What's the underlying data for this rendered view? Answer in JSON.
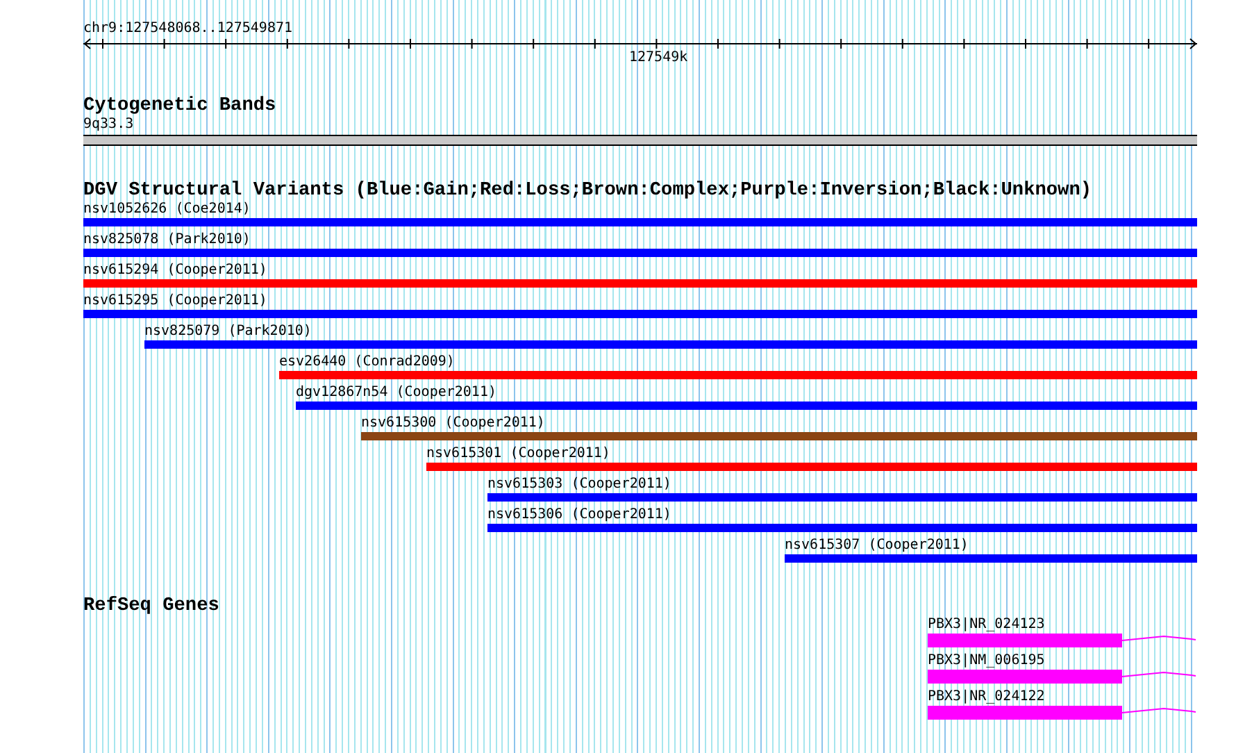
{
  "ruler": {
    "location": "chr9:127548068..127549871",
    "tick_label": "127549k"
  },
  "cytogenetic_bands": {
    "title": "Cytogenetic Bands",
    "band": "9q33.3"
  },
  "structural_variants": {
    "title": "DGV Structural Variants (Blue:Gain;Red:Loss;Brown:Complex;Purple:Inversion;Black:Unknown)",
    "features": [
      {
        "label": "nsv1052626 (Coe2014)",
        "color": "#0000ff"
      },
      {
        "label": "nsv825078 (Park2010)",
        "color": "#0000ff"
      },
      {
        "label": "nsv615294 (Cooper2011)",
        "color": "#ff0000"
      },
      {
        "label": "nsv615295 (Cooper2011)",
        "color": "#0000ff"
      },
      {
        "label": "nsv825079 (Park2010)",
        "color": "#0000ff"
      },
      {
        "label": "esv26440 (Conrad2009)",
        "color": "#ff0000"
      },
      {
        "label": "dgv12867n54 (Cooper2011)",
        "color": "#0000ff"
      },
      {
        "label": "nsv615300 (Cooper2011)",
        "color": "#8b4513"
      },
      {
        "label": "nsv615301 (Cooper2011)",
        "color": "#ff0000"
      },
      {
        "label": "nsv615303 (Cooper2011)",
        "color": "#0000ff"
      },
      {
        "label": "nsv615306 (Cooper2011)",
        "color": "#0000ff"
      },
      {
        "label": "nsv615307 (Cooper2011)",
        "color": "#0000ff"
      }
    ]
  },
  "refseq_genes": {
    "title": "RefSeq Genes",
    "genes": [
      {
        "label": "PBX3|NR_024123"
      },
      {
        "label": "PBX3|NM_006195"
      },
      {
        "label": "PBX3|NR_024122"
      }
    ]
  }
}
